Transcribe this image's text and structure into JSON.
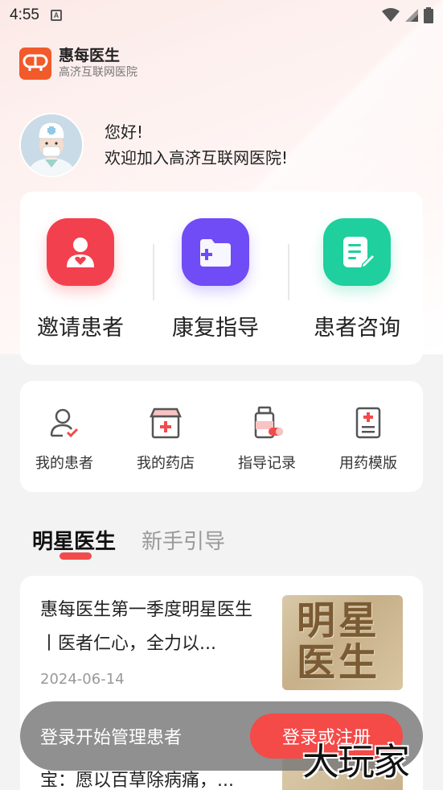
{
  "status_bar": {
    "time": "4:55",
    "notification_letter": "A"
  },
  "brand": {
    "name": "惠每医生",
    "subtitle": "高济互联网医院",
    "logo_text": "惠每医生"
  },
  "greeting": {
    "line1": "您好!",
    "line2": "欢迎加入高济互联网医院!"
  },
  "quick_actions": [
    {
      "label": "邀请患者",
      "icon": "invite-patient-icon",
      "color": "#f2404f"
    },
    {
      "label": "康复指导",
      "icon": "rehab-folder-icon",
      "color": "#6f4cf5"
    },
    {
      "label": "患者咨询",
      "icon": "consult-note-icon",
      "color": "#1fcf9d"
    }
  ],
  "tools": [
    {
      "label": "我的患者",
      "icon": "my-patients-icon"
    },
    {
      "label": "我的药店",
      "icon": "my-pharmacy-icon"
    },
    {
      "label": "指导记录",
      "icon": "guidance-record-icon"
    },
    {
      "label": "用药模版",
      "icon": "medication-template-icon"
    }
  ],
  "tabs": {
    "active": "明星医生",
    "inactive": "新手引导"
  },
  "articles": [
    {
      "title": "惠每医生第一季度明星医生丨医者仁心，全力以...",
      "date": "2024-06-14",
      "thumb_text": "明星医生"
    },
    {
      "title": "宝：愿以百草除病痛，..."
    }
  ],
  "login_banner": {
    "text": "登录开始管理患者",
    "button": "登录或注册"
  },
  "watermark": "大玩家",
  "colors": {
    "accent": "#f44a48",
    "brand": "#f15a2b"
  }
}
